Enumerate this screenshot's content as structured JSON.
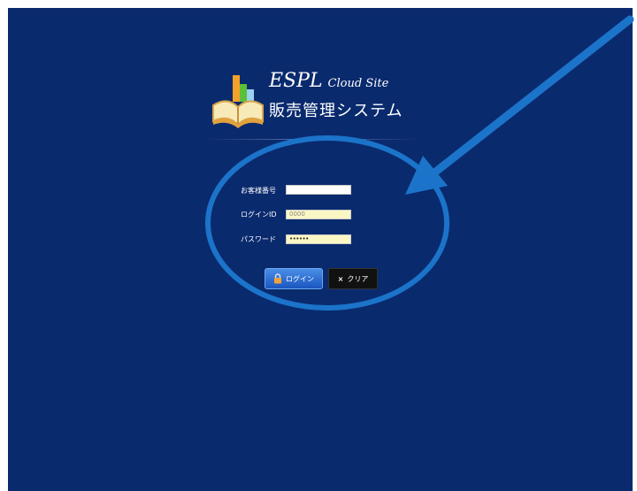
{
  "brand": {
    "name": "ESPL",
    "sub": "Cloud Site",
    "product": "販売管理システム"
  },
  "form": {
    "customer_number": {
      "label": "お客様番号",
      "value": ""
    },
    "login_id": {
      "label": "ログインID",
      "value": "0000"
    },
    "password": {
      "label": "パスワード",
      "value": "••••••"
    }
  },
  "buttons": {
    "login": "ログイン",
    "clear": "クリア",
    "clear_icon": "×"
  },
  "colors": {
    "background": "#0a2a6e",
    "annotation": "#1b74c9",
    "field_highlight": "#fbf7c4"
  },
  "icons": {
    "logo": "book-chart-icon",
    "login": "lock-icon",
    "clear": "x-icon"
  }
}
